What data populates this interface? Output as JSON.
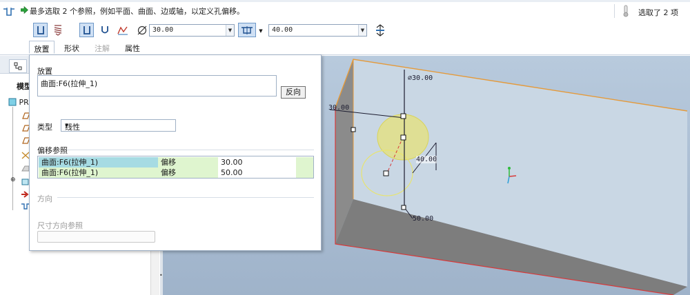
{
  "dashboard": {
    "prompt": "最多选取 2 个参照，例如平面、曲面、边或轴，以定义孔偏移。",
    "selected_count": "选取了 2 项",
    "diameter_value": "30.00",
    "depth_value": "40.00",
    "tabs": [
      {
        "label": "放置",
        "active": true,
        "enabled": true
      },
      {
        "label": "形状",
        "active": false,
        "enabled": true
      },
      {
        "label": "注解",
        "active": false,
        "enabled": false
      },
      {
        "label": "属性",
        "active": false,
        "enabled": true
      }
    ]
  },
  "tree": {
    "tab_label": "模型",
    "root_label": "PR"
  },
  "placement": {
    "section_label": "放置",
    "placement_reference": "曲面:F6(拉伸_1)",
    "flip_button": "反向",
    "type_label": "类型",
    "type_value": "线性",
    "offset_refs_label": "偏移参照",
    "offset_rows": [
      {
        "reference": "曲面:F6(拉伸_1)",
        "kind": "偏移",
        "value": "30.00",
        "selected": true
      },
      {
        "reference": "曲面:F6(拉伸_1)",
        "kind": "偏移",
        "value": "50.00",
        "selected": false
      }
    ],
    "direction_label": "方向",
    "dim_direction_label": "尺寸方向参照"
  },
  "graphics": {
    "dim_diameter": "30.00",
    "dim_offset_1": "30.00",
    "dim_depth": "40.00",
    "dim_offset_2": "50.00"
  },
  "colors": {
    "accent_selected_row": "#a6dbe3",
    "row_value_bg": "#dff5cf",
    "edge_orange": "#e59a3a",
    "edge_red": "#d83838",
    "hole_yellow": "#eaea78"
  }
}
